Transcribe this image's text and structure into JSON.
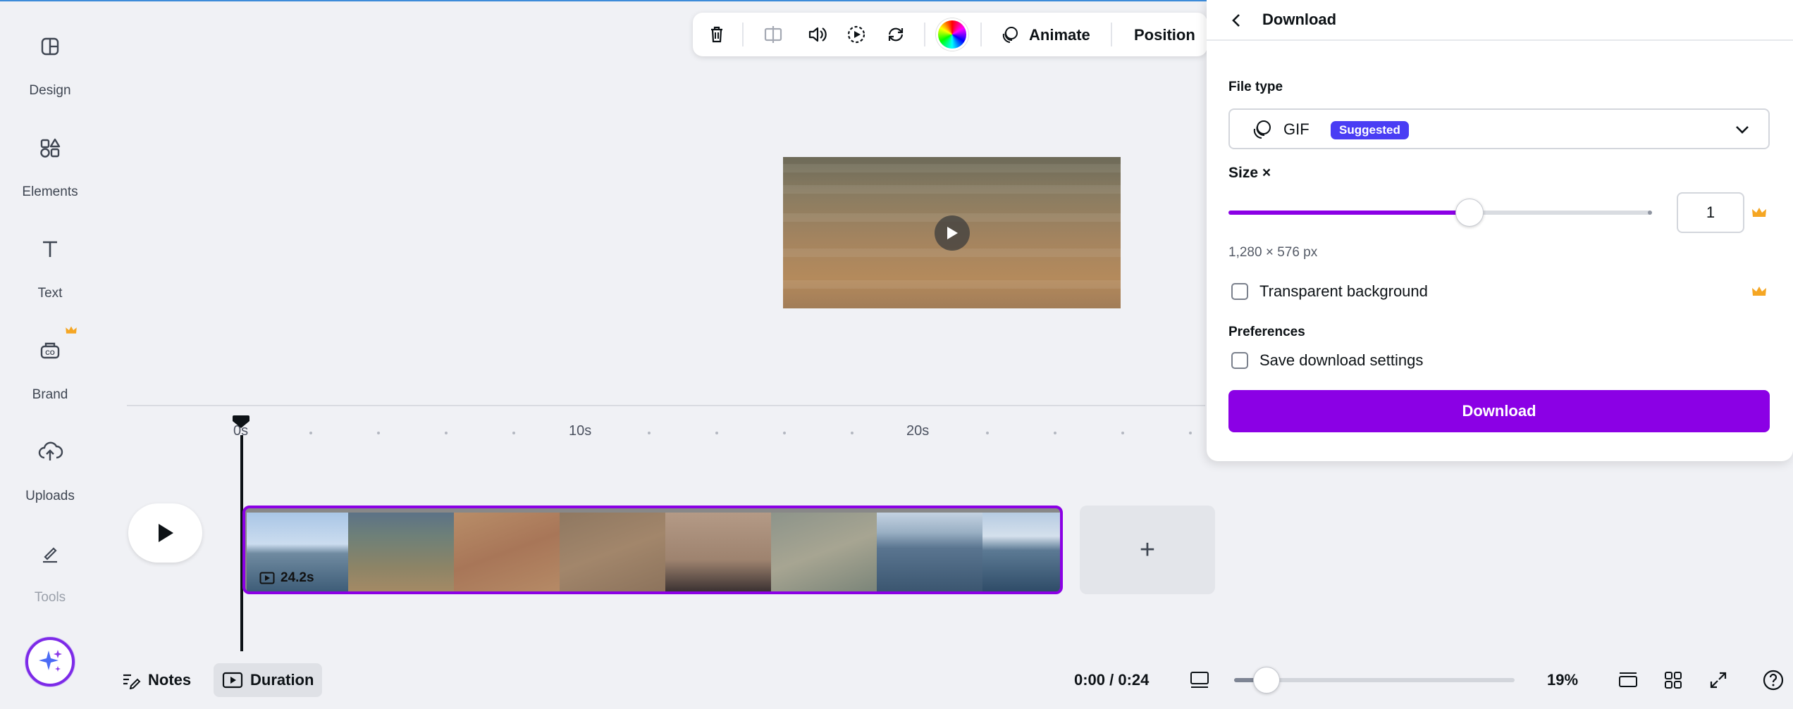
{
  "sidebar": {
    "items": [
      {
        "label": "Design",
        "icon": "design-icon"
      },
      {
        "label": "Elements",
        "icon": "elements-icon"
      },
      {
        "label": "Text",
        "icon": "text-icon"
      },
      {
        "label": "Brand",
        "icon": "brand-icon"
      },
      {
        "label": "Uploads",
        "icon": "uploads-icon"
      },
      {
        "label": "Tools",
        "icon": "tools-icon"
      }
    ]
  },
  "toolbar": {
    "animate_label": "Animate",
    "position_label": "Position"
  },
  "timeline": {
    "ticks": [
      "0s",
      "10s",
      "20s"
    ],
    "clip_duration": "24.2s",
    "add_clip_symbol": "+"
  },
  "bottom_bar": {
    "notes_label": "Notes",
    "duration_label": "Duration",
    "time": "0:00 / 0:24",
    "zoom_value": 19,
    "zoom_label": "19%"
  },
  "download_panel": {
    "title": "Download",
    "file_type_label": "File type",
    "file_type_value": "GIF",
    "suggested_badge": "Suggested",
    "size_label": "Size ×",
    "size_slider_fraction": 0.57,
    "size_value": "1",
    "dimensions": "1,280 × 576 px",
    "transparent_label": "Transparent background",
    "preferences_label": "Preferences",
    "save_settings_label": "Save download settings",
    "download_button": "Download"
  },
  "colors": {
    "accent": "#8b00e5",
    "badge": "#4a3df4",
    "crown": "#f5a623"
  }
}
